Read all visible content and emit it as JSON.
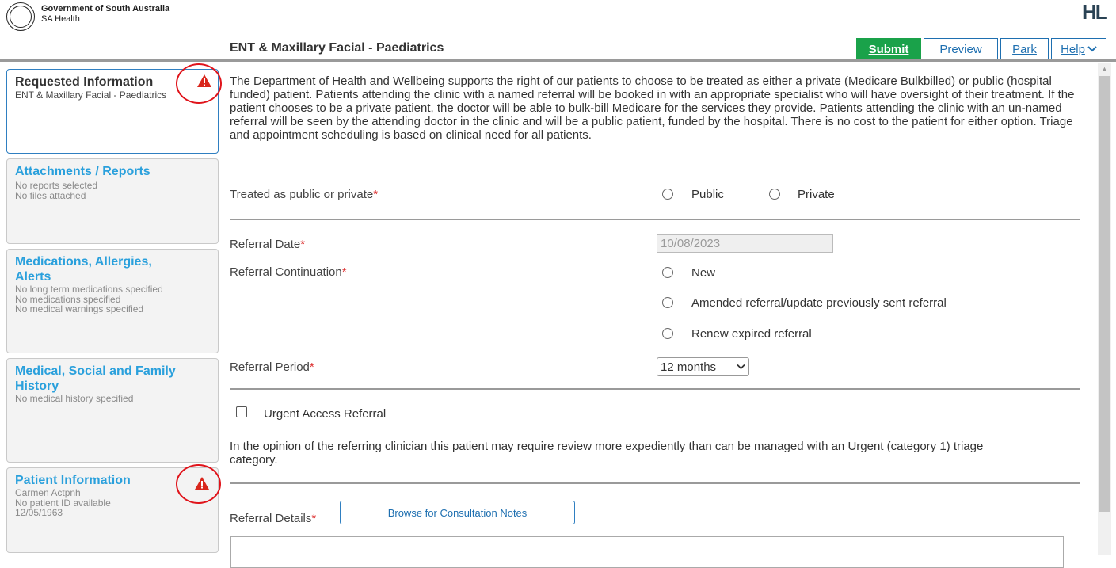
{
  "header": {
    "gov_name": "Government of South Australia",
    "gov_sub": "SA Health",
    "brand": "HL",
    "form_title": "ENT & Maxillary Facial - Paediatrics"
  },
  "toolbar": {
    "submit": "Submit",
    "preview": "Preview",
    "park": "Park",
    "help": "Help"
  },
  "sidebar": {
    "requested": {
      "title": "Requested Information",
      "sub": "ENT & Maxillary Facial - Paediatrics"
    },
    "attachments": {
      "title": "Attachments / Reports",
      "lines": [
        "No reports selected",
        "No files attached"
      ]
    },
    "medications": {
      "title_1": "Medications, Allergies,",
      "title_2": "Alerts",
      "lines": [
        "No long term medications specified",
        "No medications specified",
        "No medical warnings specified"
      ]
    },
    "history": {
      "title_1": "Medical, Social and Family",
      "title_2": "History",
      "lines": [
        "No medical history specified"
      ]
    },
    "patient": {
      "title": "Patient Information",
      "lines": [
        "Carmen Actpnh",
        "No patient ID available",
        "12/05/1963"
      ]
    }
  },
  "main": {
    "intro": "The Department of Health and Wellbeing supports the right of our patients to choose to be treated as either a private (Medicare Bulkbilled) or public (hospital funded) patient. Patients attending the clinic with a named referral will be booked in with an appropriate specialist who will have oversight of their treatment. If the patient chooses to be a private patient, the doctor will be able to bulk-bill Medicare for the services they provide. Patients attending the clinic with an un-named referral will be seen by the attending doctor in the clinic and will be a public patient, funded by the hospital. There is no cost to the patient for either option. Triage and appointment scheduling is based on clinical need for all patients.",
    "treated_label": "Treated as public or private",
    "opt_public": "Public",
    "opt_private": "Private",
    "referral_date_label": "Referral Date",
    "referral_date_value": "10/08/2023",
    "continuation_label": "Referral Continuation",
    "opt_new": "New",
    "opt_amended": "Amended referral/update previously sent referral",
    "opt_renew": "Renew expired referral",
    "period_label": "Referral Period",
    "period_value": "12 months",
    "urgent_label": "Urgent Access Referral",
    "urgent_note": "In the opinion of the referring clinician this patient may require review more expediently than can be managed with an Urgent (category 1) triage category.",
    "details_label": "Referral Details",
    "browse_button": "Browse for Consultation Notes",
    "required_mark": "*"
  },
  "colors": {
    "accent": "#2aa0dc",
    "submit": "#1aa24a",
    "alert": "#e0141b"
  }
}
